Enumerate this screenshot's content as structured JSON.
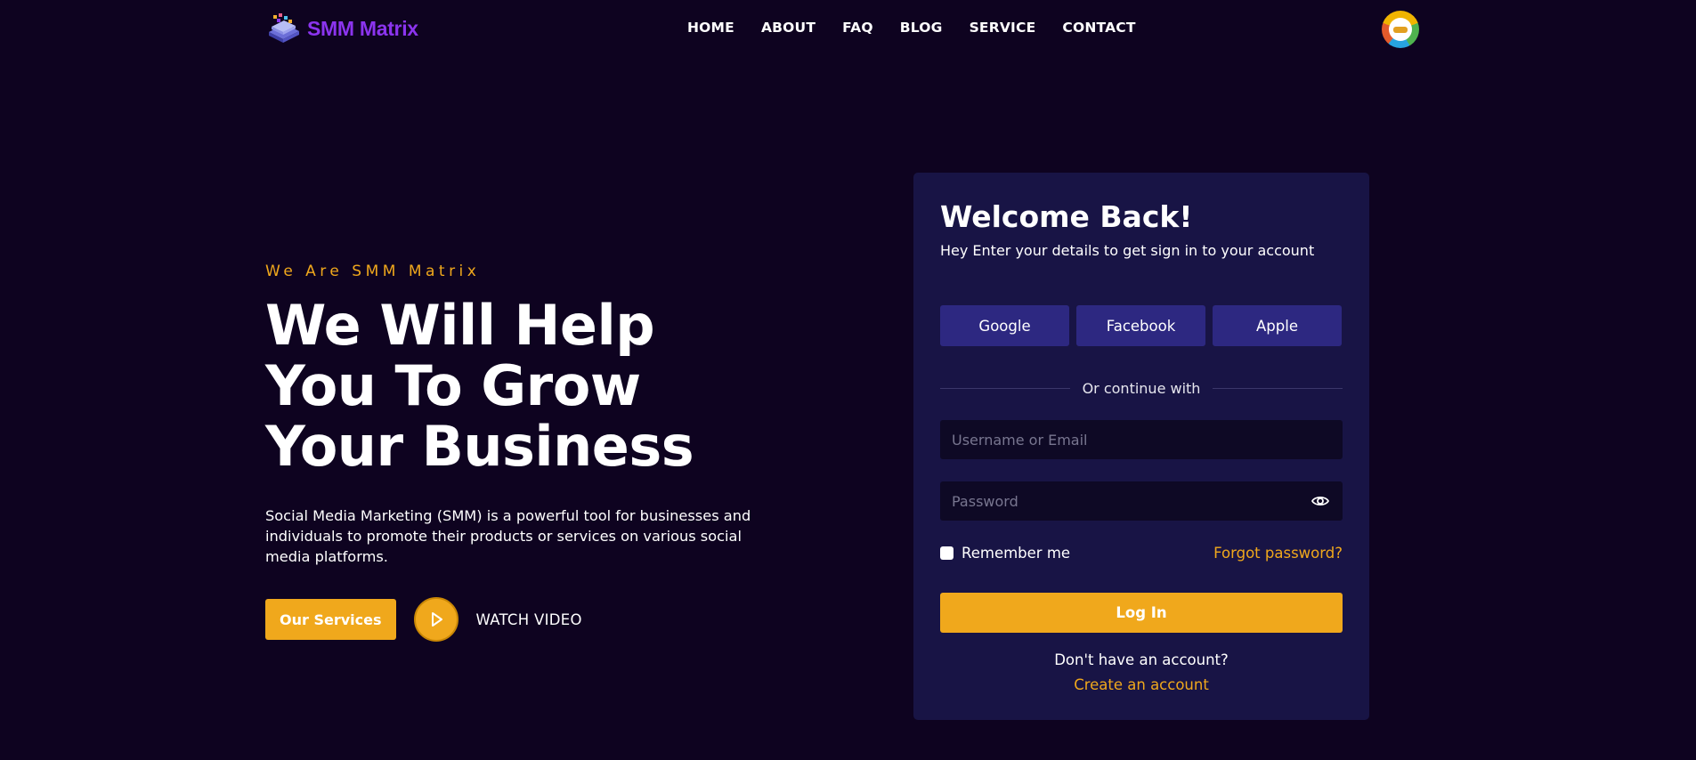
{
  "header": {
    "logo_text": "SMM Matrix",
    "logo_icon": "isometric-cube-stack-icon",
    "nav": [
      "HOME",
      "ABOUT",
      "FAQ",
      "BLOG",
      "SERVICE",
      "CONTACT"
    ],
    "avatar_icon": "user-avatar-icon"
  },
  "hero": {
    "eyebrow": "We Are SMM Matrix",
    "headline": "We Will Help You To Grow Your Business",
    "description": "Social Media Marketing (SMM) is a powerful tool for businesses and individuals to promote their products or services on various social media platforms.",
    "services_button": "Our Services",
    "play_icon": "play-icon",
    "watch_label": "WATCH VIDEO"
  },
  "login": {
    "title": "Welcome Back!",
    "subtitle": "Hey Enter your details to get sign in to your account",
    "social_buttons": [
      "Google",
      "Facebook",
      "Apple"
    ],
    "divider": "Or continue with",
    "username_placeholder": "Username or Email",
    "password_placeholder": "Password",
    "eye_icon": "eye-icon",
    "remember_label": "Remember me",
    "remember_checked": false,
    "forgot_label": "Forgot password?",
    "login_button": "Log In",
    "no_account_text": "Don't have an account?",
    "create_account_label": "Create an account"
  },
  "colors": {
    "background": "#0e0320",
    "card": "#181445",
    "social_button": "#2d2881",
    "accent": "#f0a81c",
    "logo_purple": "#8b34ee",
    "input_bg": "#0e0925"
  }
}
